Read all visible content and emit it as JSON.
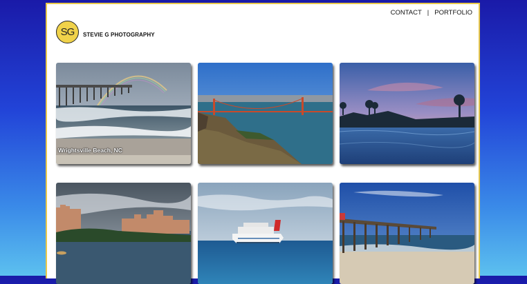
{
  "nav": {
    "contact": "CONTACT",
    "separator": "|",
    "portfolio": "PORTFOLIO"
  },
  "logo": {
    "initials": "SG",
    "name": "STEVIE G PHOTOGRAPHY"
  },
  "gallery": [
    {
      "caption": "Wrightsville Beach, NC"
    }
  ]
}
